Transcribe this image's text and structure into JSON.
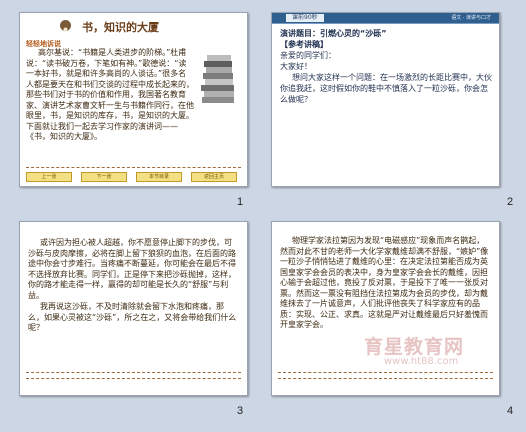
{
  "slides": [
    {
      "number": "1",
      "title": "书，知识的大厦",
      "section_label": "轻轻地诉说",
      "paragraphs": [
        "高尔基说：“书籍是人类进步的阶梯。”杜甫说：“读书破万卷，下笔如有神。”歌德说：“读一本好书，就是和许多高尚的人谈话。”很多名人都是要天在和书们交谈的过程中成长起来的，那些书们对于书的价值和作用，我国著名教育家、演讲艺术家曹文轩一生与书籍作同行，在他眼里，书，是知识的库存，书，是知识的大厦。下面就让我们一起去学习作家的演讲词——《书，知识的大厦》。"
      ],
      "nav_buttons": [
        "上一张",
        "下一张",
        "本节目录",
        "返回主页"
      ]
    },
    {
      "number": "2",
      "header_tab": "课前90秒",
      "header_right": "语文 · 演讲与口才",
      "lines": [
        "演讲题目：引燃心灵的“沙砾”",
        "【参考讲稿】",
        "亲爱的同学们：",
        "大家好！",
        "想问大家这样一个问题：在一场激烈的长距比赛中，大伙你追我赶，这时假如你的鞋中不慎落入了一粒沙砾，你会怎么做呢？"
      ]
    },
    {
      "number": "3",
      "paragraphs": [
        "或许因为担心被人超越，你不愿意停止脚下的步伐，可沙砾与皮肉摩擦，必将在脚上留下狼狈的血泡，在后面的路途中你会寸步难行。当疼痛不断蔓延，你可能会在最后不得不选择放弃比赛。同学们，正是停下来把沙砾抛掉，这样，你的路才能走得一样，赢得的却可能是长久的“舒服”与利益。",
        "我再说这沙砾，不及时清除就会留下水泡和疼痛，那么，如果心灵被这“沙砾”，所之在之，又将会带给我们什么呢？"
      ]
    },
    {
      "number": "4",
      "paragraphs": [
        "物理学家法拉第因为发现“电磁感应”现象而声名鹊起，然而对此不甘的老师一大化学家戴维却满不舒服，“嫉妒”像一粒沙子悄悄钻进了戴维的心里：在决定法拉第能否成为英国皇家学会会员的表决中，身为皇家学会会长的戴维，因担心输于会超过他，竟投了反对票，于是投下了唯一一张反对票。然而这一票没有阻挡住法拉第成为会员的步伐，却为戴维抹去了一片诚意声，人们批评他丧失了科学家应有的品质：实现、公正、求真。这就是严对让戴维最后只好羞愧而开皇家学会。"
      ],
      "watermark_cn": "育星教育网",
      "watermark_url": "www.ht88.com"
    }
  ]
}
